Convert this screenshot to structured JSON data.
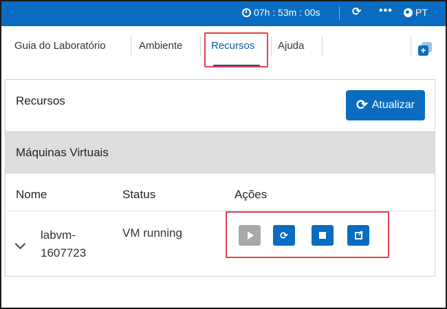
{
  "topbar": {
    "timer": "07h : 53m : 00s",
    "language": "PT",
    "icons": {
      "clock": "clock-icon",
      "refresh": "refresh-icon",
      "more": "more-icon",
      "globe": "globe-icon"
    }
  },
  "tabs": [
    {
      "label": "Guia do Laboratório"
    },
    {
      "label": "Ambiente"
    },
    {
      "label": "Recursos",
      "active": true
    },
    {
      "label": "Ajuda"
    }
  ],
  "resources": {
    "title": "Recursos",
    "refresh_label": "Atualizar",
    "section_title": "Máquinas Virtuais",
    "columns": [
      "Nome",
      "Status",
      "Ações"
    ],
    "vms": [
      {
        "name": "labvm-1607723",
        "status": "VM running"
      }
    ],
    "actions": [
      "start-icon",
      "restart-icon",
      "stop-icon",
      "open-external-icon"
    ]
  },
  "colors": {
    "accent": "#0a6cc0",
    "highlight": "#e0414c",
    "disabled": "#a8a8a8"
  }
}
